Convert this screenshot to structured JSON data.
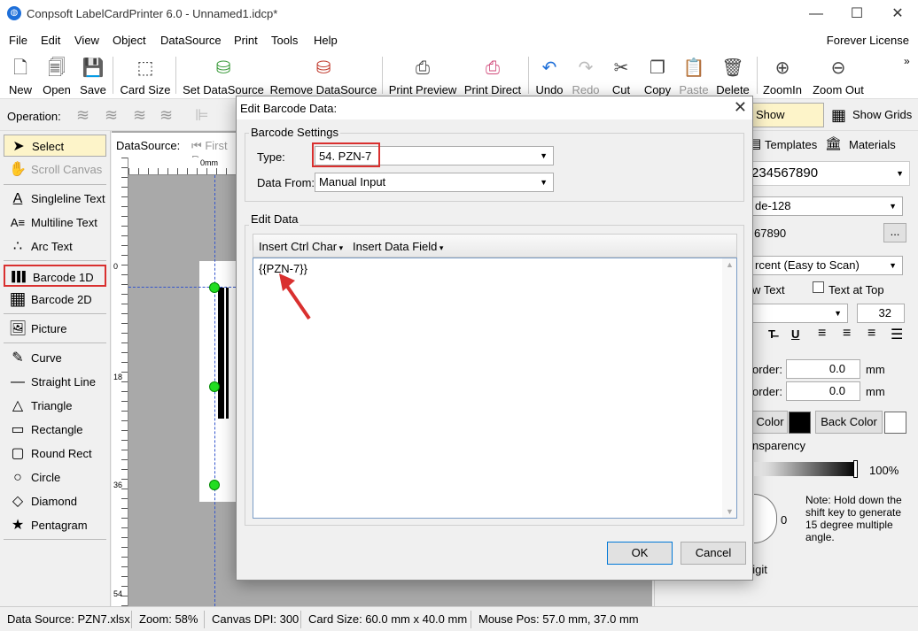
{
  "app": {
    "title": "Conpsoft LabelCardPrinter 6.0 - Unnamed1.idcp*"
  },
  "menus": [
    "File",
    "Edit",
    "View",
    "Object",
    "DataSource",
    "Print",
    "Tools",
    "Help"
  ],
  "license": "Forever License",
  "toolbar": [
    {
      "label": "New",
      "icon": "new-file-icon",
      "glyph": "🗋"
    },
    {
      "label": "Open",
      "icon": "open-icon",
      "glyph": "🗐"
    },
    {
      "label": "Save",
      "icon": "save-icon",
      "glyph": "💾"
    },
    {
      "label": "Card Size",
      "icon": "card-size-icon",
      "glyph": "⬚"
    },
    {
      "label": "Set DataSource",
      "icon": "set-datasource-icon",
      "glyph": "⛁"
    },
    {
      "label": "Remove DataSource",
      "icon": "remove-datasource-icon",
      "glyph": "⛁"
    },
    {
      "label": "Print Preview",
      "icon": "print-preview-icon",
      "glyph": "⎙"
    },
    {
      "label": "Print Direct",
      "icon": "print-direct-icon",
      "glyph": "⎙"
    },
    {
      "label": "Undo",
      "icon": "undo-icon",
      "glyph": "↶"
    },
    {
      "label": "Redo",
      "icon": "redo-icon",
      "glyph": "↷"
    },
    {
      "label": "Cut",
      "icon": "cut-icon",
      "glyph": "✂"
    },
    {
      "label": "Copy",
      "icon": "copy-icon",
      "glyph": "❐"
    },
    {
      "label": "Paste",
      "icon": "paste-icon",
      "glyph": "📋"
    },
    {
      "label": "Delete",
      "icon": "delete-icon",
      "glyph": "🗑"
    },
    {
      "label": "ZoomIn",
      "icon": "zoom-in-icon",
      "glyph": "⊕"
    },
    {
      "label": "Zoom Out",
      "icon": "zoom-out-icon",
      "glyph": "⊖"
    }
  ],
  "operation_label": "Operation:",
  "show_guides": "Show Guides",
  "show_grids": "Show Grids",
  "tools": [
    {
      "label": "Select",
      "glyph": "➤",
      "icon": "select-arrow-icon"
    },
    {
      "label": "Scroll Canvas",
      "glyph": "✋",
      "icon": "hand-icon"
    },
    {
      "label": "Singleline Text",
      "glyph": "A",
      "icon": "singleline-text-icon"
    },
    {
      "label": "Multiline Text",
      "glyph": "A≡",
      "icon": "multiline-text-icon"
    },
    {
      "label": "Arc Text",
      "glyph": "∴",
      "icon": "arc-text-icon"
    },
    {
      "label": "Barcode 1D",
      "glyph": "▌▌▌",
      "icon": "barcode-1d-icon"
    },
    {
      "label": "Barcode 2D",
      "glyph": "▦",
      "icon": "barcode-2d-icon"
    },
    {
      "label": "Picture",
      "glyph": "🖼",
      "icon": "picture-icon"
    },
    {
      "label": "Curve",
      "glyph": "✎",
      "icon": "curve-icon"
    },
    {
      "label": "Straight Line",
      "glyph": "—",
      "icon": "line-icon"
    },
    {
      "label": "Triangle",
      "glyph": "△",
      "icon": "triangle-icon"
    },
    {
      "label": "Rectangle",
      "glyph": "▭",
      "icon": "rectangle-icon"
    },
    {
      "label": "Round Rect",
      "glyph": "▢",
      "icon": "round-rect-icon"
    },
    {
      "label": "Circle",
      "glyph": "○",
      "icon": "circle-icon"
    },
    {
      "label": "Diamond",
      "glyph": "◇",
      "icon": "diamond-icon"
    },
    {
      "label": "Pentagram",
      "glyph": "★",
      "icon": "star-icon"
    }
  ],
  "datasource_bar": {
    "label": "DataSource:",
    "first": "First R"
  },
  "ruler": {
    "top_label": "0mm",
    "left_marks": [
      "0",
      "18",
      "36",
      "54"
    ]
  },
  "right_panel": {
    "tabs": [
      "Templates",
      "Materials"
    ],
    "data_value": "234567890",
    "type_value": "de-128",
    "check_value": "67890",
    "check_btn": "...",
    "scan_value": "rcent (Easy to Scan)",
    "show_text": "w Text",
    "text_at_top": "Text at Top",
    "font_size": "32",
    "border1_label": "order:",
    "border1_value": "0.0",
    "border2_label": "order:",
    "border2_value": "0.0",
    "unit": "mm",
    "fore_color": "Color",
    "back_color": "Back Color",
    "transparency": "nsparency",
    "transparency_value": "100%",
    "angle_value": "0",
    "note": "Note: Hold down the shift key to generate 15 degree multiple angle.",
    "auto_check": "Auto Check Digit"
  },
  "dialog": {
    "title": "Edit Barcode Data:",
    "settings_group": "Barcode Settings",
    "type_label": "Type:",
    "type_value": "54.  PZN-7",
    "from_label": "Data From:",
    "from_value": "Manual Input",
    "edit_group": "Edit Data",
    "insert_ctrl": "Insert Ctrl Char",
    "insert_field": "Insert Data Field",
    "content": "{{PZN-7}}",
    "ok": "OK",
    "cancel": "Cancel"
  },
  "status": {
    "datasource": "Data Source: PZN7.xlsx",
    "zoom": "Zoom: 58%",
    "dpi": "Canvas DPI: 300",
    "card_size": "Card Size: 60.0 mm x 40.0 mm",
    "mouse": "Mouse Pos: 57.0 mm, 37.0 mm"
  },
  "colors": {
    "accent": "#0078d7",
    "highlight": "#d9302f",
    "handle": "#22dd22"
  }
}
